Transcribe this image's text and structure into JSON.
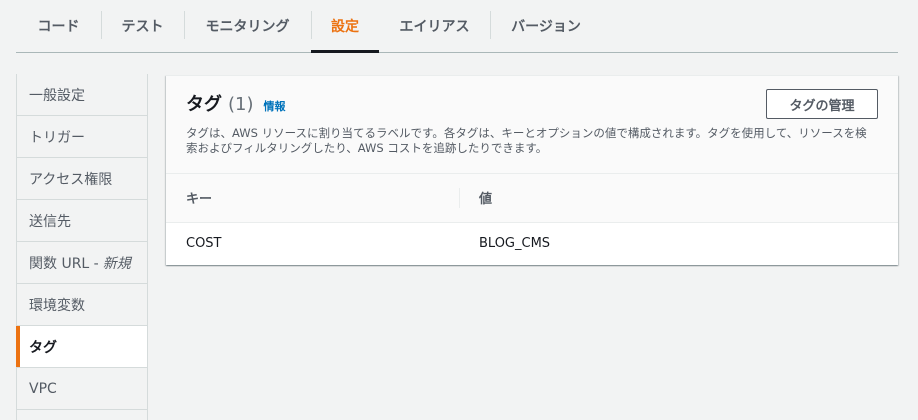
{
  "tabs": [
    {
      "label": "コード"
    },
    {
      "label": "テスト"
    },
    {
      "label": "モニタリング"
    },
    {
      "label": "設定",
      "active": true
    },
    {
      "label": "エイリアス"
    },
    {
      "label": "バージョン"
    }
  ],
  "sidenav": {
    "items": [
      {
        "label": "一般設定"
      },
      {
        "label": "トリガー"
      },
      {
        "label": "アクセス権限"
      },
      {
        "label": "送信先"
      },
      {
        "label": "関数 URL -",
        "suffix": "新規"
      },
      {
        "label": "環境変数"
      },
      {
        "label": "タグ",
        "active": true
      },
      {
        "label": "VPC"
      }
    ]
  },
  "panel": {
    "title": "タグ",
    "count": "(1)",
    "info_link": "情報",
    "manage_button": "タグの管理",
    "description": "タグは、AWS リソースに割り当てるラベルです。各タグは、キーとオプションの値で構成されます。タグを使用して、リソースを検索およびフィルタリングしたり、AWS コストを追跡したりできます。",
    "table": {
      "headers": {
        "key": "キー",
        "value": "値"
      },
      "rows": [
        {
          "key": "COST",
          "value": "BLOG_CMS"
        }
      ]
    }
  },
  "colors": {
    "accent": "#ec7211",
    "link": "#0073bb",
    "background": "#f2f3f3"
  }
}
